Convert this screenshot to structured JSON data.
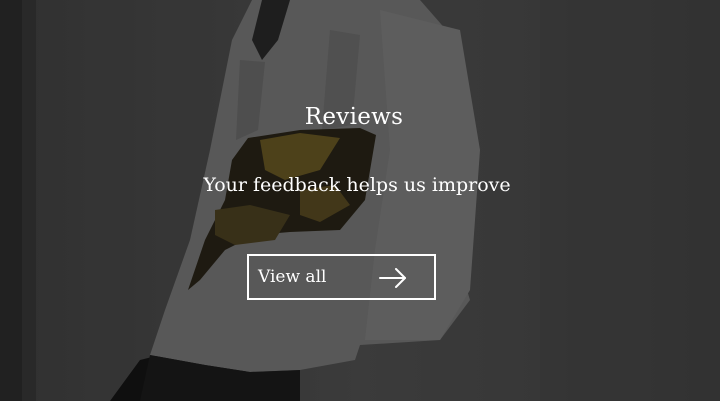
{
  "hero": {
    "title": "Reviews",
    "subtitle": "Your feedback helps us improve",
    "cta_label": "View all",
    "cta_icon": "arrow-right-icon",
    "background_image": "woman-white-shirt-obi-belt-photo"
  },
  "colors": {
    "text": "#ffffff",
    "border": "#ffffff",
    "overlay": "#000000"
  }
}
